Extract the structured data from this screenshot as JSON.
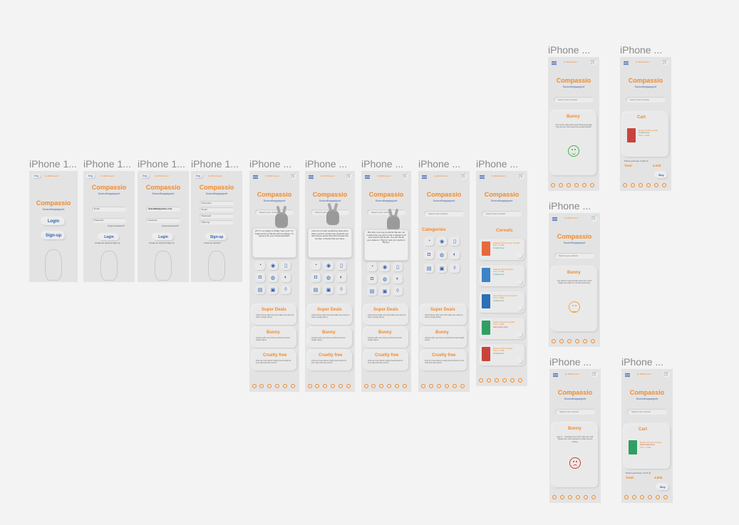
{
  "frames": {
    "f1": {
      "title": "iPhone 1..."
    },
    "f2": {
      "title": "iPhone 1..."
    },
    "f3": {
      "title": "iPhone 1..."
    },
    "f4": {
      "title": "iPhone 1..."
    },
    "f5": {
      "title": "iPhone ..."
    },
    "f6": {
      "title": "iPhone ..."
    },
    "f7": {
      "title": "iPhone ..."
    },
    "f8": {
      "title": "iPhone ..."
    },
    "f9": {
      "title": "iPhone ..."
    },
    "f10": {
      "title": "iPhone ..."
    },
    "f11": {
      "title": "iPhone ..."
    },
    "f12": {
      "title": "iPhone ..."
    },
    "f13": {
      "title": "iPhone ..."
    },
    "f14": {
      "title": "iPhone ..."
    }
  },
  "app": {
    "logo": "Compassio",
    "tagline": "Sourcufhopyarpport",
    "lang": "Eng",
    "by": "by Birthcheel.it",
    "search_placeholder": "Search your product",
    "login_label": "Login",
    "signup_label": "Sign-up"
  },
  "login": {
    "email_placeholder": "Email",
    "password_placeholder": "Password",
    "email_value": "anastelika@yahoo.com",
    "password_value": "••••••••••••",
    "forgot": "Forgot password?",
    "no_account": "Create an account Sign up"
  },
  "signup": {
    "username": "Username",
    "email": "Email",
    "password": "Password",
    "warning": "Warning",
    "have_account": "I have an account"
  },
  "popups": {
    "p1": "Hi!! I'm so happy to finally meet you!! I'm Sugar! and my friends call me Happy. I'm going to be your virtual assistant.",
    "p2": "Now let me start explaining. Everytime when you buy cruelty-free products you will receive points that will increase the number of Ifoods that you have.",
    "p3": "But when you buy products that are not cruelty-free you just my life in danger and lose points and ifoods. You can check your status in \"Bunny\" and your points in \"Bunny\"."
  },
  "home": {
    "categories": "Categories",
    "cards": [
      {
        "title": "Super Deals",
        "desc": "Check these right now and make sure that you have enough points."
      },
      {
        "title": "Bunny",
        "desc": "Interact with your bunny and find out their health status."
      },
      {
        "title": "Cruelty free",
        "desc": "Find out more about cruelty-free brands for your help and earn points."
      }
    ],
    "nav": [
      "Favourites",
      "Brands",
      "Wishlist",
      "Categories",
      "Account",
      "Settings"
    ]
  },
  "cereals": {
    "title": "Cereals",
    "items": [
      {
        "name": "Kellogg's Froot Loops Cereals",
        "price": "Price: 4.49$",
        "tag": "Cruelty Free",
        "color": "#e8683d"
      },
      {
        "name": "Kellogg's Rice Krispies",
        "price": "Price: 3.49$",
        "tag": "Cruelty Free",
        "color": "#3d83c7"
      },
      {
        "name": "Post Golden Crisp Cereals",
        "price": "Price: 3.99$",
        "tag": "Cruelty Free",
        "color": "#2b6fb5"
      },
      {
        "name": "Nestle Cheerios Cereals",
        "price": "Price: 3.09$",
        "tag": "Fail Cruelty Free",
        "color": "#2f9f64"
      },
      {
        "name": "Rosarin Puffs Cereals",
        "price": "Price: 4.29$",
        "tag": "Cruelty Free",
        "color": "#c8443b"
      }
    ],
    "add_label": "Add to cart"
  },
  "bunny": {
    "title": "Bunny",
    "happy": "Your bunny state looks good! Keep going like this and you will receive the actual reward!!",
    "neutral": "You haven't hoovered this week too much! Maybe the pillar it's not that interesting.",
    "sad": "Ugnnn... I apologize but I don't feel very well. Please pay more attention to what you are buying."
  },
  "cart": {
    "title": "Cart",
    "item1_name": "Rosarin Puffs Cereals",
    "item1_tag": "Cruelty Free",
    "item1_price": "Price: 4.29$",
    "item2_name": "Nestle Cheerios Cereals",
    "item2_tag": "Fail Cruelty Free",
    "item2_price": "Price: 3.09$",
    "points1": "Points you'll get: 3 (CF 3)",
    "total1_label": "Total:",
    "total1": "4.04$",
    "points2": "Points you'll lose: 3 (CF 3)",
    "total2_label": "Total:",
    "total2": "4.80$",
    "buy": "Buy"
  }
}
